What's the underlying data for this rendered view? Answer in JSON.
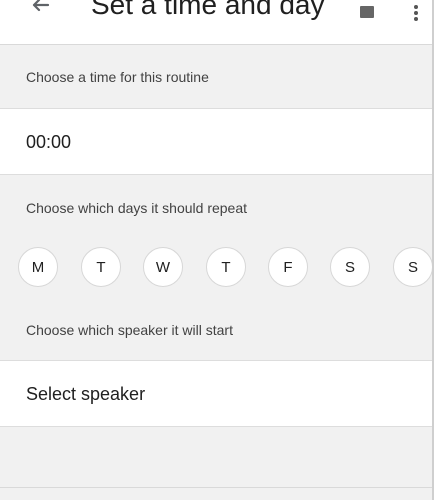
{
  "header": {
    "title": "Set a time and day",
    "back_icon": "arrow-left-icon",
    "save_icon": "save-icon",
    "more_icon": "more-vert-icon"
  },
  "time_section": {
    "label": "Choose a time for this routine",
    "value": "00:00"
  },
  "days_section": {
    "label": "Choose which days it should repeat",
    "days": [
      "M",
      "T",
      "W",
      "T",
      "F",
      "S",
      "S"
    ]
  },
  "speaker_section": {
    "label": "Choose which speaker it will start",
    "value": "Select speaker"
  },
  "colors": {
    "background": "#f1f1f1",
    "surface": "#ffffff",
    "text": "#212121",
    "label_text": "#424242",
    "divider": "#dddddd"
  }
}
